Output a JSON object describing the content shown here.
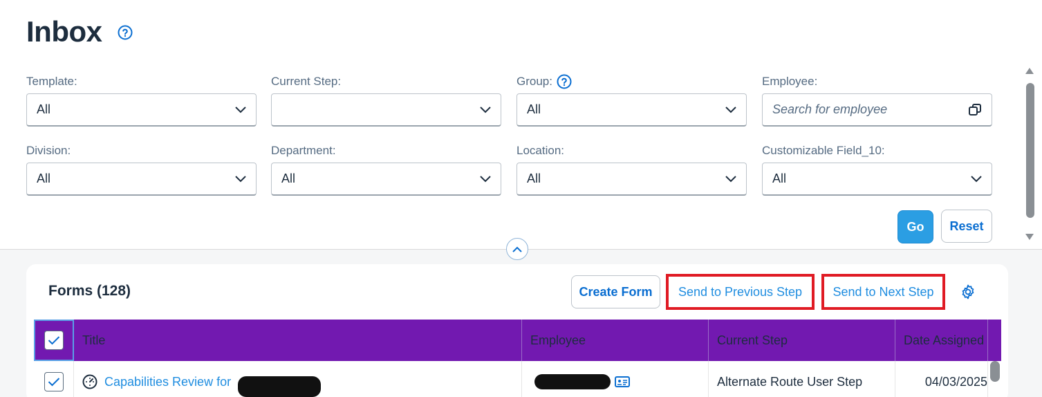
{
  "page": {
    "title": "Inbox"
  },
  "filters": [
    {
      "label": "Template:",
      "value": "All",
      "type": "select"
    },
    {
      "label": "Current Step:",
      "value": "",
      "type": "select"
    },
    {
      "label": "Group:",
      "value": "All",
      "type": "select",
      "help": true
    },
    {
      "label": "Employee:",
      "placeholder": "Search for employee",
      "type": "search"
    },
    {
      "label": "Division:",
      "value": "All",
      "type": "select"
    },
    {
      "label": "Department:",
      "value": "All",
      "type": "select"
    },
    {
      "label": "Location:",
      "value": "All",
      "type": "select"
    },
    {
      "label": "Customizable Field_10:",
      "value": "All",
      "type": "select"
    }
  ],
  "actions": {
    "go": "Go",
    "reset": "Reset"
  },
  "forms": {
    "title": "Forms (128)",
    "create": "Create Form",
    "send_previous": "Send to Previous Step",
    "send_next": "Send to Next Step",
    "columns": [
      "Title",
      "Employee",
      "Current Step",
      "Date Assigned"
    ],
    "rows": [
      {
        "title": "Capabilities Review for",
        "employee": "",
        "current_step": "Alternate Route User Step",
        "date_assigned": "04/03/2025",
        "checked": true
      }
    ]
  },
  "colors": {
    "header_bg": "#7219b0",
    "accent": "#0a6ed1",
    "go_bg": "#2b9ee3",
    "highlight_border": "#e01b24"
  },
  "icons": {
    "title_help": "help-circle-icon",
    "group_help": "help-circle-icon",
    "dropdown": "chevron-down-icon",
    "employee_picker": "value-help-icon",
    "collapse": "chevron-up-icon",
    "settings": "gear-icon",
    "form_type": "gauge-icon",
    "employee_card": "contact-card-icon",
    "check": "checkmark-icon"
  }
}
